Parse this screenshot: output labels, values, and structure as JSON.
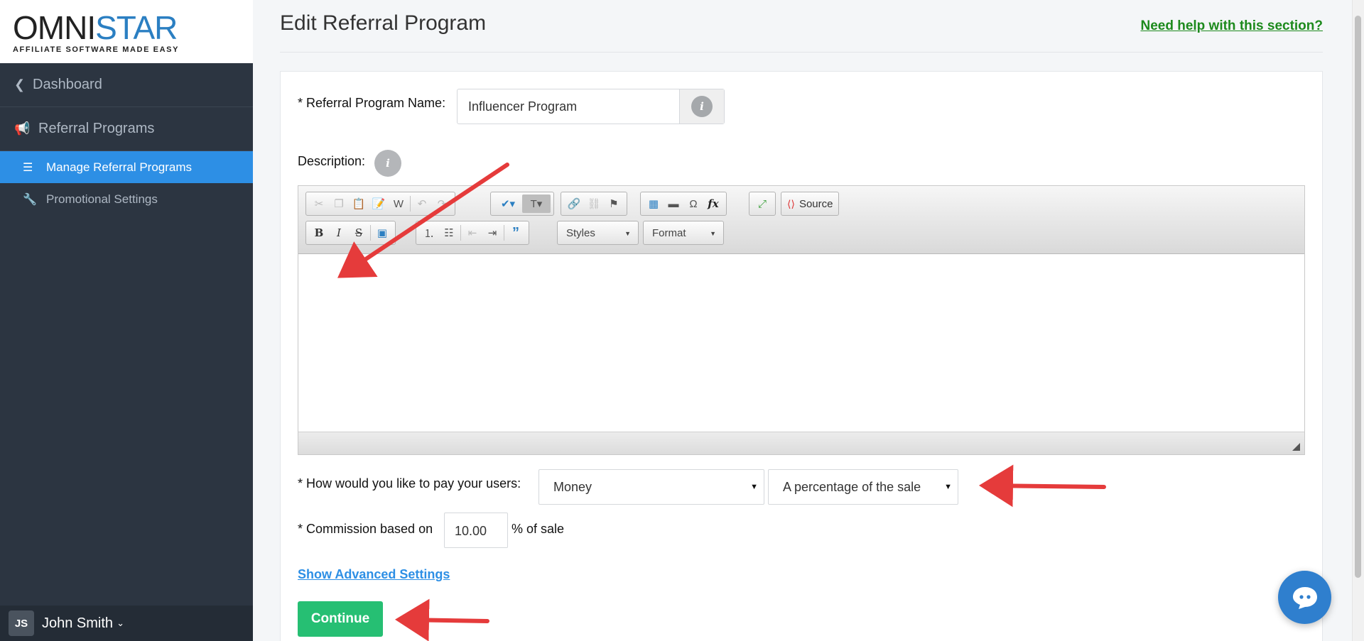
{
  "logo": {
    "omni": "OMNI",
    "s": "S",
    "star": "TAR",
    "tagline": "AFFILIATE SOFTWARE MADE EASY"
  },
  "sidebar": {
    "back_label": "Dashboard",
    "section_label": "Referral Programs",
    "items": [
      {
        "label": "Manage Referral Programs",
        "active": true,
        "icon": "list-icon"
      },
      {
        "label": "Promotional Settings",
        "active": false,
        "icon": "wrench-icon"
      }
    ]
  },
  "user": {
    "initials": "JS",
    "name": "John Smith"
  },
  "header": {
    "title": "Edit Referral Program",
    "help_link": "Need help with this section?"
  },
  "form": {
    "name_label": "* Referral Program Name:",
    "name_value": "Influencer Program",
    "description_label": "Description:",
    "pay_label": "* How would you like to pay your users:",
    "pay_type": "Money",
    "pay_method": "A percentage of the sale",
    "commission_label": "* Commission based on",
    "commission_value": "10.00",
    "commission_suffix": "% of sale",
    "advanced_link": "Show Advanced Settings",
    "continue_label": "Continue"
  },
  "editor": {
    "source_label": "Source",
    "styles_label": "Styles",
    "format_label": "Format"
  },
  "colors": {
    "sidebar": "#2c3541",
    "active": "#2d8fe5",
    "help_link": "#1d8a1d",
    "continue": "#26bf73",
    "annotation_arrow": "#e53b3b"
  }
}
